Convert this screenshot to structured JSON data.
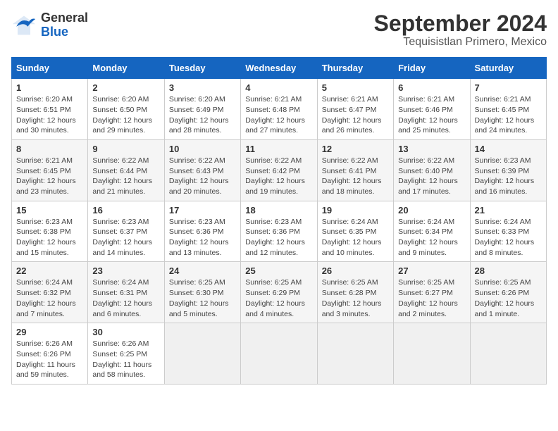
{
  "header": {
    "logo_line1": "General",
    "logo_line2": "Blue",
    "title": "September 2024",
    "subtitle": "Tequisistlan Primero, Mexico"
  },
  "calendar": {
    "days_of_week": [
      "Sunday",
      "Monday",
      "Tuesday",
      "Wednesday",
      "Thursday",
      "Friday",
      "Saturday"
    ],
    "weeks": [
      [
        {
          "day": "",
          "info": ""
        },
        {
          "day": "",
          "info": ""
        },
        {
          "day": "",
          "info": ""
        },
        {
          "day": "",
          "info": ""
        },
        {
          "day": "",
          "info": ""
        },
        {
          "day": "",
          "info": ""
        },
        {
          "day": "",
          "info": ""
        }
      ]
    ],
    "cells": [
      {
        "day": "1",
        "info": "Sunrise: 6:20 AM\nSunset: 6:51 PM\nDaylight: 12 hours\nand 30 minutes."
      },
      {
        "day": "2",
        "info": "Sunrise: 6:20 AM\nSunset: 6:50 PM\nDaylight: 12 hours\nand 29 minutes."
      },
      {
        "day": "3",
        "info": "Sunrise: 6:20 AM\nSunset: 6:49 PM\nDaylight: 12 hours\nand 28 minutes."
      },
      {
        "day": "4",
        "info": "Sunrise: 6:21 AM\nSunset: 6:48 PM\nDaylight: 12 hours\nand 27 minutes."
      },
      {
        "day": "5",
        "info": "Sunrise: 6:21 AM\nSunset: 6:47 PM\nDaylight: 12 hours\nand 26 minutes."
      },
      {
        "day": "6",
        "info": "Sunrise: 6:21 AM\nSunset: 6:46 PM\nDaylight: 12 hours\nand 25 minutes."
      },
      {
        "day": "7",
        "info": "Sunrise: 6:21 AM\nSunset: 6:45 PM\nDaylight: 12 hours\nand 24 minutes."
      },
      {
        "day": "8",
        "info": "Sunrise: 6:21 AM\nSunset: 6:45 PM\nDaylight: 12 hours\nand 23 minutes."
      },
      {
        "day": "9",
        "info": "Sunrise: 6:22 AM\nSunset: 6:44 PM\nDaylight: 12 hours\nand 21 minutes."
      },
      {
        "day": "10",
        "info": "Sunrise: 6:22 AM\nSunset: 6:43 PM\nDaylight: 12 hours\nand 20 minutes."
      },
      {
        "day": "11",
        "info": "Sunrise: 6:22 AM\nSunset: 6:42 PM\nDaylight: 12 hours\nand 19 minutes."
      },
      {
        "day": "12",
        "info": "Sunrise: 6:22 AM\nSunset: 6:41 PM\nDaylight: 12 hours\nand 18 minutes."
      },
      {
        "day": "13",
        "info": "Sunrise: 6:22 AM\nSunset: 6:40 PM\nDaylight: 12 hours\nand 17 minutes."
      },
      {
        "day": "14",
        "info": "Sunrise: 6:23 AM\nSunset: 6:39 PM\nDaylight: 12 hours\nand 16 minutes."
      },
      {
        "day": "15",
        "info": "Sunrise: 6:23 AM\nSunset: 6:38 PM\nDaylight: 12 hours\nand 15 minutes."
      },
      {
        "day": "16",
        "info": "Sunrise: 6:23 AM\nSunset: 6:37 PM\nDaylight: 12 hours\nand 14 minutes."
      },
      {
        "day": "17",
        "info": "Sunrise: 6:23 AM\nSunset: 6:36 PM\nDaylight: 12 hours\nand 13 minutes."
      },
      {
        "day": "18",
        "info": "Sunrise: 6:23 AM\nSunset: 6:36 PM\nDaylight: 12 hours\nand 12 minutes."
      },
      {
        "day": "19",
        "info": "Sunrise: 6:24 AM\nSunset: 6:35 PM\nDaylight: 12 hours\nand 10 minutes."
      },
      {
        "day": "20",
        "info": "Sunrise: 6:24 AM\nSunset: 6:34 PM\nDaylight: 12 hours\nand 9 minutes."
      },
      {
        "day": "21",
        "info": "Sunrise: 6:24 AM\nSunset: 6:33 PM\nDaylight: 12 hours\nand 8 minutes."
      },
      {
        "day": "22",
        "info": "Sunrise: 6:24 AM\nSunset: 6:32 PM\nDaylight: 12 hours\nand 7 minutes."
      },
      {
        "day": "23",
        "info": "Sunrise: 6:24 AM\nSunset: 6:31 PM\nDaylight: 12 hours\nand 6 minutes."
      },
      {
        "day": "24",
        "info": "Sunrise: 6:25 AM\nSunset: 6:30 PM\nDaylight: 12 hours\nand 5 minutes."
      },
      {
        "day": "25",
        "info": "Sunrise: 6:25 AM\nSunset: 6:29 PM\nDaylight: 12 hours\nand 4 minutes."
      },
      {
        "day": "26",
        "info": "Sunrise: 6:25 AM\nSunset: 6:28 PM\nDaylight: 12 hours\nand 3 minutes."
      },
      {
        "day": "27",
        "info": "Sunrise: 6:25 AM\nSunset: 6:27 PM\nDaylight: 12 hours\nand 2 minutes."
      },
      {
        "day": "28",
        "info": "Sunrise: 6:25 AM\nSunset: 6:26 PM\nDaylight: 12 hours\nand 1 minute."
      },
      {
        "day": "29",
        "info": "Sunrise: 6:26 AM\nSunset: 6:26 PM\nDaylight: 11 hours\nand 59 minutes."
      },
      {
        "day": "30",
        "info": "Sunrise: 6:26 AM\nSunset: 6:25 PM\nDaylight: 11 hours\nand 58 minutes."
      }
    ]
  }
}
